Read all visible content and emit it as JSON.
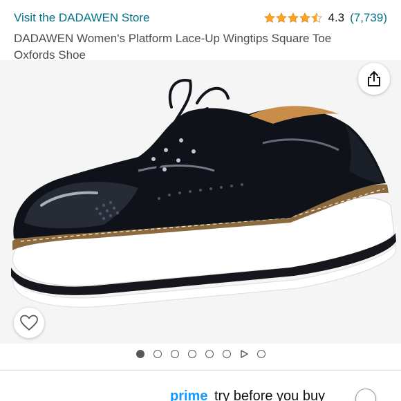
{
  "header": {
    "store_link": "Visit the DADAWEN Store",
    "rating_value": "4.3",
    "rating_count": "(7,739)",
    "rating_stars": 4.3,
    "product_title": "DADAWEN Women's Platform Lace-Up Wingtips Square Toe Oxfords Shoe"
  },
  "gallery": {
    "image_name": "black-patent-platform-oxford-shoe",
    "share_icon": "share-icon",
    "wishlist_icon": "heart-icon",
    "dots_total": 8,
    "dots_active_index": 0,
    "video_dot_index": 6
  },
  "prime": {
    "brand": "prime",
    "text": "try before you buy"
  },
  "colors": {
    "link": "#007185",
    "star": "#ffa41c",
    "prime_blue": "#1399ff"
  }
}
